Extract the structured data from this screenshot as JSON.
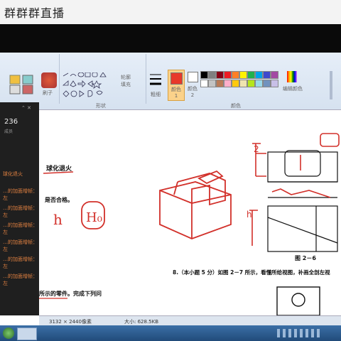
{
  "header": {
    "title": "群群群直播"
  },
  "ribbon": {
    "group_shapes_label": "形状",
    "group_colors_label": "颜色",
    "brush_label": "刷子",
    "outline_label": "轮廓",
    "fill_label": "填充",
    "size_label": "粗细",
    "color1_label": "颜色 1",
    "color2_label": "颜色 2",
    "edit_colors_label": "编辑颜色",
    "color1": "#e8392a",
    "color2": "#ffffff"
  },
  "side_panel": {
    "count": "236",
    "subtitle": "成员",
    "messages": [
      "球化退火",
      "…的加面增帧：左",
      "…的加面增帧：左",
      "…的加面增帧：左",
      "…的加面增帧：左",
      "…的加面增帧：左",
      "…的加面增帧：左"
    ]
  },
  "document": {
    "text_anneal": "球化退火",
    "text_pass": "是否合格。",
    "figure_caption": "图 2－6",
    "question8": "8.（本小题 5 分）如图 2－7 所示，看懂所给视图，补画全剖左视",
    "question_parts": "所示的零件。完成下列问",
    "handwriting_h": "h",
    "handwriting_h0": "H₀"
  },
  "statusbar": {
    "dimensions": "3132 × 2440像素",
    "filesize": "大小: 628.5KB"
  },
  "palette": [
    "#000000",
    "#7f7f7f",
    "#880015",
    "#ed1c24",
    "#ff7f27",
    "#fff200",
    "#22b14c",
    "#00a2e8",
    "#3f48cc",
    "#a349a4",
    "#ffffff",
    "#c3c3c3",
    "#b97a57",
    "#ffaec9",
    "#ffc90e",
    "#efe4b0",
    "#b5e61d",
    "#99d9ea",
    "#7092be",
    "#c8bfe7"
  ]
}
